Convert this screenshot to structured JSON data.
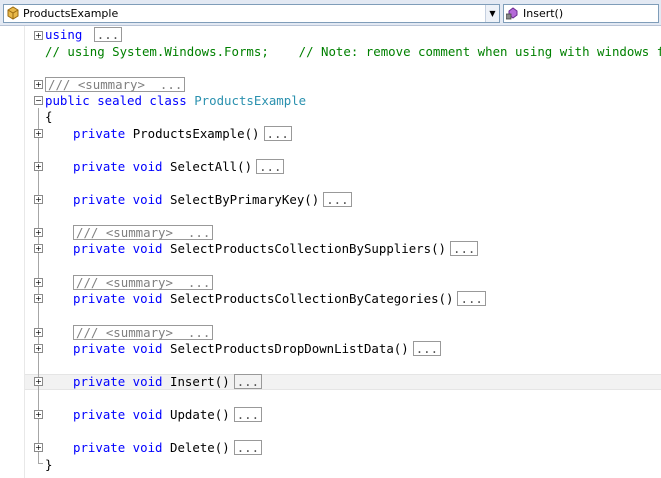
{
  "navbar": {
    "type_combo": "ProductsExample",
    "member_combo": "Insert()"
  },
  "collapsed_marker": "...",
  "summary_text": "/// <summary>  ...",
  "lines": {
    "l0": {
      "kw": "using",
      "rest": ""
    },
    "l1": {
      "comment": "// using System.Windows.Forms;    // Note: remove comment when using with windows forms"
    },
    "l3": {
      "summary": "/// <summary>  ..."
    },
    "l4": {
      "kw": "public sealed class",
      "type": "ProductsExample"
    },
    "l5": {
      "text": "{"
    },
    "l6": {
      "kw": "private",
      "rest": "ProductsExample()"
    },
    "l8": {
      "kw": "private void",
      "rest": "SelectAll()"
    },
    "l10": {
      "kw": "private void",
      "rest": "SelectByPrimaryKey()"
    },
    "l12": {
      "summary": "/// <summary>  ..."
    },
    "l13": {
      "kw": "private void",
      "rest": "SelectProductsCollectionBySuppliers()"
    },
    "l15": {
      "summary": "/// <summary>  ..."
    },
    "l16": {
      "kw": "private void",
      "rest": "SelectProductsCollectionByCategories()"
    },
    "l18": {
      "summary": "/// <summary>  ..."
    },
    "l19": {
      "kw": "private void",
      "rest": "SelectProductsDropDownListData()"
    },
    "l21": {
      "kw": "private void",
      "rest": "Insert()"
    },
    "l23": {
      "kw": "private void",
      "rest": "Update()"
    },
    "l25": {
      "kw": "private void",
      "rest": "Delete()"
    },
    "l27": {
      "text": "}"
    }
  }
}
